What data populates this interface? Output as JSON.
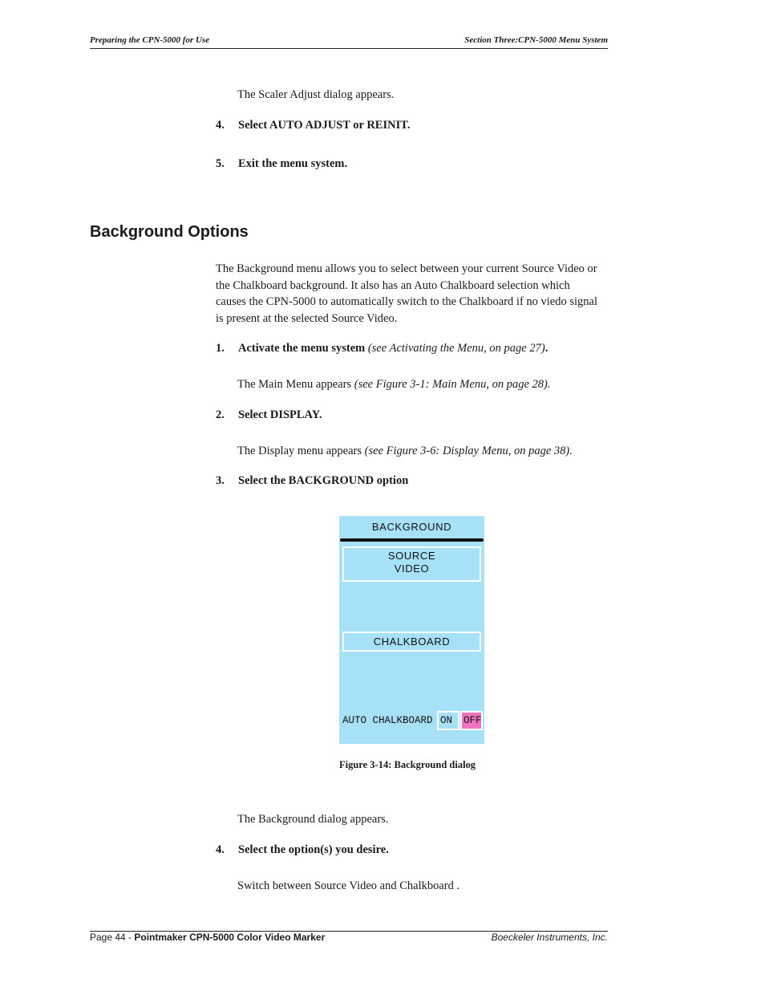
{
  "header": {
    "left": "Preparing the CPN-5000 for Use",
    "right": "Section Three:CPN-5000 Menu System"
  },
  "intro_lines": {
    "scaler_appears": "The Scaler Adjust dialog appears.",
    "step4_prev": {
      "num": "4.",
      "text": "Select AUTO ADJUST or REINIT."
    },
    "step5_prev": {
      "num": "5.",
      "text": "Exit the menu system."
    }
  },
  "section": {
    "heading": "Background Options",
    "paragraph": [
      "The Background menu allows you to select between your current Source Video or",
      "the Chalkboard background. It also has an Auto Chalkboard selection which",
      "causes the CPN-5000 to automatically switch to the Chalkboard if no viedo signal",
      "is present at the selected Source Video."
    ],
    "steps": [
      {
        "num": "1.",
        "text": "Activate the menu system",
        "ref": "(see Activating the Menu, on page 27)",
        "trail": ".",
        "result": "The Main Menu appears",
        "result_ref": "(see Figure 3-1: Main Menu, on page 28)."
      },
      {
        "num": "2.",
        "text": "Select DISPLAY.",
        "result": "The Display menu appears",
        "result_ref": "(see Figure 3-6: Display Menu, on page 38)."
      },
      {
        "num": "3.",
        "text": "Select the BACKGROUND option"
      },
      {
        "num": "4.",
        "text": "Select the option(s) you desire.",
        "result": "Switch between Source Video and Chalkboard ."
      }
    ],
    "after_figure": "The Background dialog appears."
  },
  "dialog": {
    "title": "BACKGROUND",
    "option_source": [
      "SOURCE",
      "VIDEO"
    ],
    "option_chalkboard": "CHALKBOARD",
    "auto_label": "AUTO CHALKBOARD",
    "on_label": "ON",
    "off_label": "OFF",
    "selected": "OFF",
    "colors": {
      "background": "#a6e1f7",
      "selected": "#f072c0"
    }
  },
  "figure_caption": "Figure 3-14:  Background dialog",
  "footer": {
    "page": "Page 44 - ",
    "title": "Pointmaker CPN-5000 Color Video Marker",
    "company": "Boeckeler Instruments, Inc."
  }
}
